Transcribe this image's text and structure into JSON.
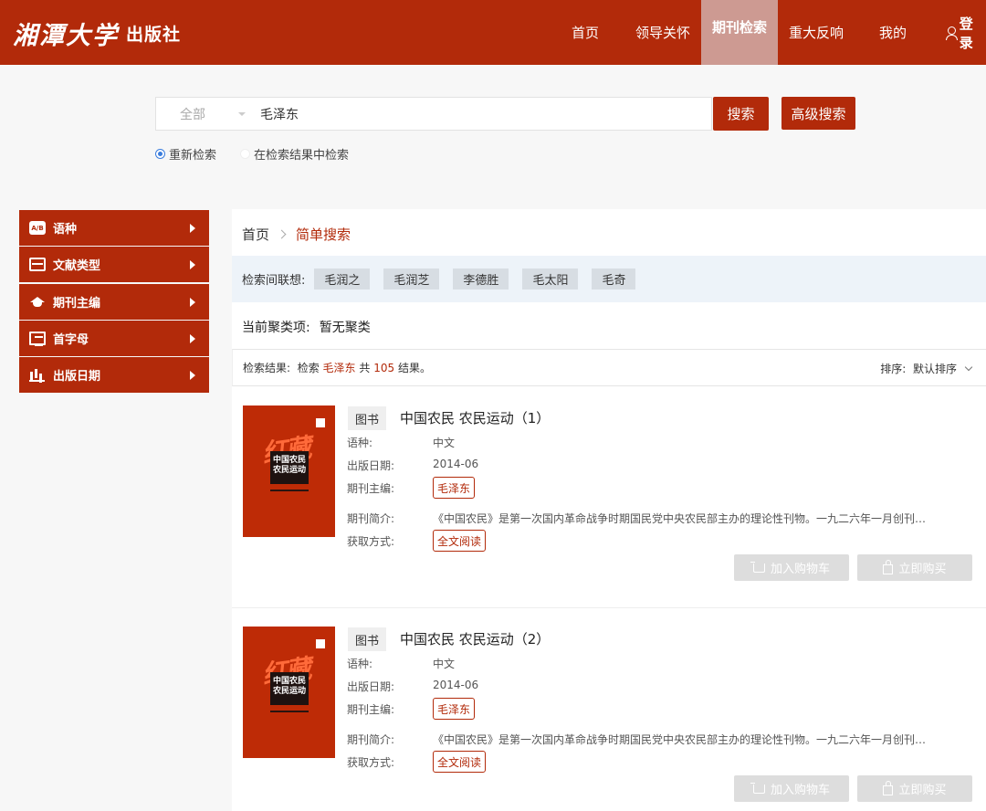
{
  "header": {
    "logo_main": "湘潭大学",
    "logo_sub": "出版社",
    "nav": [
      "首页",
      "领导关怀",
      "期刊检索",
      "重大反响",
      "我的"
    ],
    "login": "登录",
    "active_nav": "期刊检索"
  },
  "search": {
    "scope": "全部",
    "query": "毛泽东",
    "search_button": "搜索",
    "advanced_button": "高级搜索",
    "radio_new": "重新检索",
    "radio_within": "在检索结果中检索"
  },
  "sidebar": {
    "items": [
      {
        "label": "语种",
        "icon": "language-icon"
      },
      {
        "label": "文献类型",
        "icon": "document-type-icon"
      },
      {
        "label": "期刊主编",
        "icon": "graduation-cap-icon"
      },
      {
        "label": "首字母",
        "icon": "pages-icon"
      },
      {
        "label": "出版日期",
        "icon": "bar-chart-icon"
      }
    ]
  },
  "breadcrumb": {
    "home": "首页",
    "current": "简单搜索"
  },
  "association": {
    "label": "检索间联想:",
    "tags": [
      "毛润之",
      "毛润芝",
      "李德胜",
      "毛太阳",
      "毛奇"
    ]
  },
  "cluster": {
    "label": "当前聚类项:",
    "value": "暂无聚类"
  },
  "results": {
    "label": "检索结果:",
    "search_word": "检索",
    "keyword": "毛泽东",
    "total_word": "共",
    "count": "105",
    "suffix": "结果。",
    "sort_label": "排序:",
    "sort_value": "默认排序"
  },
  "labels": {
    "language": "语种:",
    "pub_date": "出版日期:",
    "editor": "期刊主编:",
    "summary": "期刊简介:",
    "access": "获取方式:",
    "add_cart": "加入购物车",
    "buy_now": "立即购买"
  },
  "books": [
    {
      "category": "图书",
      "title": "中国农民 农民运动（1）",
      "language": "中文",
      "pub_date": "2014-06",
      "editor": "毛泽东",
      "summary": "《中国农民》是第一次国内革命战争时期国民党中央农民部主办的理论性刊物。一九二六年一月创刊…",
      "access": "全文阅读",
      "cover_red_text": "红藏",
      "cover_title": "中国农民 农民运动"
    },
    {
      "category": "图书",
      "title": "中国农民 农民运动（2）",
      "language": "中文",
      "pub_date": "2014-06",
      "editor": "毛泽东",
      "summary": "《中国农民》是第一次国内革命战争时期国民党中央农民部主办的理论性刊物。一九二六年一月创刊…",
      "access": "全文阅读",
      "cover_red_text": "红藏",
      "cover_title": "中国农民 农民运动"
    }
  ],
  "colors": {
    "brand": "#b22a0a",
    "active_nav_bg": "#cd9a92",
    "tag_bg": "#d7dde3",
    "assoc_bg": "#edf3f9",
    "disabled_button": "#dddddd"
  }
}
